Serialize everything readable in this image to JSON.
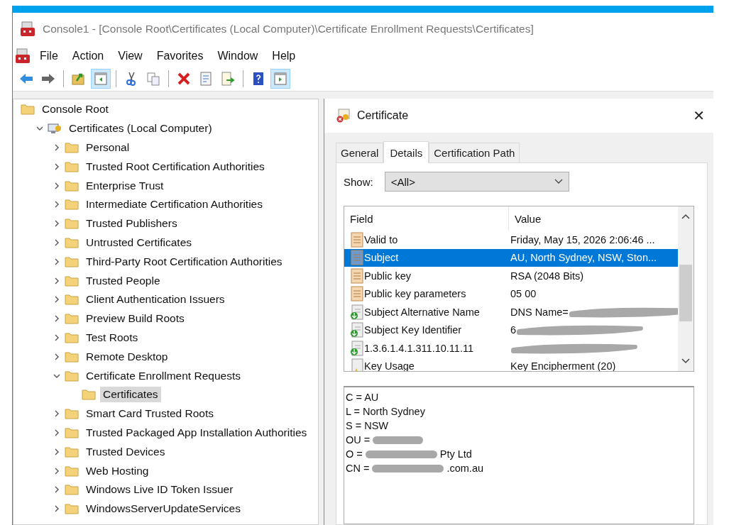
{
  "window": {
    "title": "Console1 - [Console Root\\Certificates (Local Computer)\\Certificate Enrollment Requests\\Certificates]"
  },
  "menu": [
    "File",
    "Action",
    "View",
    "Favorites",
    "Window",
    "Help"
  ],
  "toolbar": [
    [
      {
        "kind": "back",
        "on": false
      },
      {
        "kind": "forward",
        "on": false
      }
    ],
    [
      {
        "kind": "up",
        "on": false
      },
      {
        "kind": "tree",
        "on": true
      }
    ],
    [
      {
        "kind": "cut",
        "on": false
      },
      {
        "kind": "copy",
        "on": false
      }
    ],
    [
      {
        "kind": "delete",
        "on": false
      },
      {
        "kind": "properties",
        "on": false
      },
      {
        "kind": "export",
        "on": false
      }
    ],
    [
      {
        "kind": "help",
        "on": false
      },
      {
        "kind": "action",
        "on": true
      }
    ]
  ],
  "tree": [
    {
      "label": "Console Root",
      "kind": "console",
      "selected": false,
      "children": [
        {
          "label": "Certificates (Local Computer)",
          "kind": "computer",
          "expanded": true,
          "selected": false,
          "children": [
            {
              "label": "Personal",
              "kind": "store",
              "expanded": false,
              "selected": false
            },
            {
              "label": "Trusted Root Certification Authorities",
              "kind": "store",
              "expanded": false,
              "selected": false
            },
            {
              "label": "Enterprise Trust",
              "kind": "store",
              "expanded": false,
              "selected": false
            },
            {
              "label": "Intermediate Certification Authorities",
              "kind": "store",
              "expanded": false,
              "selected": false
            },
            {
              "label": "Trusted Publishers",
              "kind": "store",
              "expanded": false,
              "selected": false
            },
            {
              "label": "Untrusted Certificates",
              "kind": "store",
              "expanded": false,
              "selected": false
            },
            {
              "label": "Third-Party Root Certification Authorities",
              "kind": "store",
              "expanded": false,
              "selected": false
            },
            {
              "label": "Trusted People",
              "kind": "store",
              "expanded": false,
              "selected": false
            },
            {
              "label": "Client Authentication Issuers",
              "kind": "store",
              "expanded": false,
              "selected": false
            },
            {
              "label": "Preview Build Roots",
              "kind": "store",
              "expanded": false,
              "selected": false
            },
            {
              "label": "Test Roots",
              "kind": "store",
              "expanded": false,
              "selected": false
            },
            {
              "label": "Remote Desktop",
              "kind": "store",
              "expanded": false,
              "selected": false
            },
            {
              "label": "Certificate Enrollment Requests",
              "kind": "store",
              "expanded": true,
              "selected": false,
              "children": [
                {
                  "label": "Certificates",
                  "kind": "leaf",
                  "selected": true
                }
              ]
            },
            {
              "label": "Smart Card Trusted Roots",
              "kind": "store",
              "expanded": false,
              "selected": false
            },
            {
              "label": "Trusted Packaged App Installation Authorities",
              "kind": "store",
              "expanded": false,
              "selected": false
            },
            {
              "label": "Trusted Devices",
              "kind": "store",
              "expanded": false,
              "selected": false
            },
            {
              "label": "Web Hosting",
              "kind": "store",
              "expanded": false,
              "selected": false
            },
            {
              "label": "Windows Live ID Token Issuer",
              "kind": "store",
              "expanded": false,
              "selected": false
            },
            {
              "label": "WindowsServerUpdateServices",
              "kind": "store",
              "expanded": false,
              "selected": false
            }
          ]
        }
      ]
    }
  ],
  "dialog": {
    "title": "Certificate",
    "close": "✕",
    "tabs": [
      {
        "label": "General",
        "selected": false
      },
      {
        "label": "Details",
        "selected": true
      },
      {
        "label": "Certification Path",
        "selected": false
      }
    ],
    "show_label": "Show:",
    "show_value": "<All>",
    "columns": [
      "Field",
      "Value"
    ],
    "rows": [
      {
        "field": "Valid to",
        "kind": "property",
        "value": "Friday, May 15, 2026 2:06:46 ...",
        "redacted": false,
        "selected": false
      },
      {
        "field": "Subject",
        "kind": "property",
        "value": "AU, North Sydney, NSW, Ston...",
        "redacted": false,
        "selected": true
      },
      {
        "field": "Public key",
        "kind": "property",
        "value": "RSA (2048 Bits)",
        "redacted": false,
        "selected": false
      },
      {
        "field": "Public key parameters",
        "kind": "property",
        "value": "05 00",
        "redacted": false,
        "selected": false
      },
      {
        "field": "Subject Alternative Name",
        "kind": "extension",
        "value": "DNS Name=",
        "redacted": true,
        "selected": false
      },
      {
        "field": "Subject Key Identifier",
        "kind": "extension",
        "value": "6",
        "redacted": true,
        "selected": false
      },
      {
        "field": "1.3.6.1.4.1.311.10.11.11",
        "kind": "extension",
        "redacted": true,
        "selected": false
      },
      {
        "field": "Key Usage",
        "kind": "critical",
        "value": "Key Encipherment (20)",
        "redacted": false,
        "selected": false
      }
    ],
    "detail_lines": [
      {
        "text": "C = AU",
        "redacted": false
      },
      {
        "text": "L = North Sydney",
        "redacted": false
      },
      {
        "text": "S = NSW",
        "redacted": false
      },
      {
        "text": "OU =",
        "redacted": true
      },
      {
        "text": "O =",
        "redacted": true,
        "after": "Pty Ltd"
      },
      {
        "text": "CN =",
        "redacted": true,
        "after": ".com.au"
      }
    ]
  }
}
